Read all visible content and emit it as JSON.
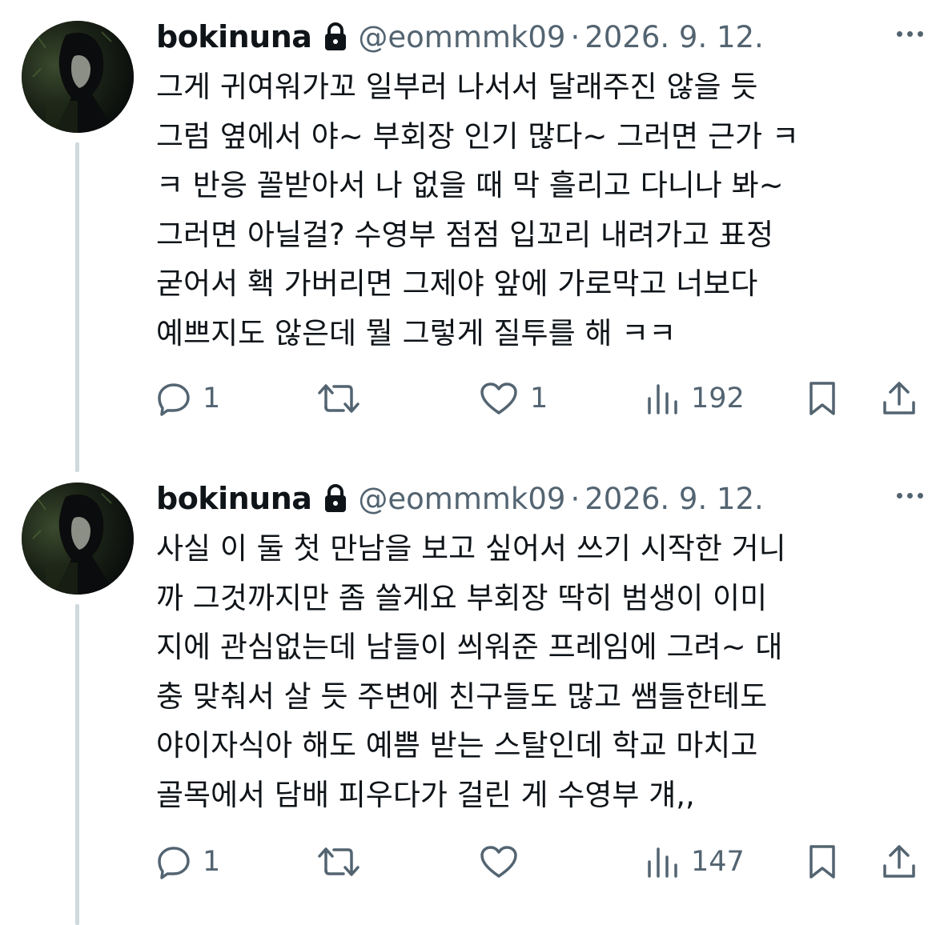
{
  "tweets": [
    {
      "display_name": "bokinuna",
      "handle": "@eommmk09",
      "separator": "·",
      "date": "2026. 9. 12.",
      "lines": [
        "그게 귀여워가꼬 일부러 나서서 달래주진 않을 듯",
        "그럼 옆에서 야~ 부회장 인기 많다~ 그러면 근가 ㅋ",
        "ㅋ 반응 꼴받아서 나 없을 때 막 흘리고 다니나 봐~",
        "그러면 아닐걸? 수영부 점점 입꼬리 내려가고 표정",
        "굳어서 홱 가버리면 그제야 앞에 가로막고 너보다",
        "예쁘지도 않은데 뭘 그렇게 질투를 해 ㅋㅋ"
      ],
      "replies": "1",
      "retweets": "",
      "likes": "1",
      "views": "192"
    },
    {
      "display_name": "bokinuna",
      "handle": "@eommmk09",
      "separator": "·",
      "date": "2026. 9. 12.",
      "lines": [
        "사실 이 둘 첫 만남을 보고 싶어서 쓰기 시작한 거니",
        "까 그것까지만 좀 쓸게요 부회장 딱히 범생이 이미",
        "지에 관심없는데 남들이 씌워준 프레임에 그려~ 대",
        "충 맞춰서 살 듯 주변에 친구들도 많고 쌤들한테도",
        "야이자식아 해도 예쁨 받는 스탈인데 학교 마치고",
        "골목에서 담배 피우다가 걸린 게 수영부 걔,,"
      ],
      "replies": "1",
      "retweets": "",
      "likes": "",
      "views": "147"
    }
  ],
  "icons": {
    "lock": "lock-icon",
    "more": "more-icon",
    "reply": "reply-icon",
    "retweet": "retweet-icon",
    "like": "heart-icon",
    "views": "views-icon",
    "bookmark": "bookmark-icon",
    "share": "share-icon"
  },
  "colors": {
    "text": "#0f1419",
    "secondary": "#536471",
    "thread_line": "#cfd9de",
    "background": "#ffffff"
  }
}
